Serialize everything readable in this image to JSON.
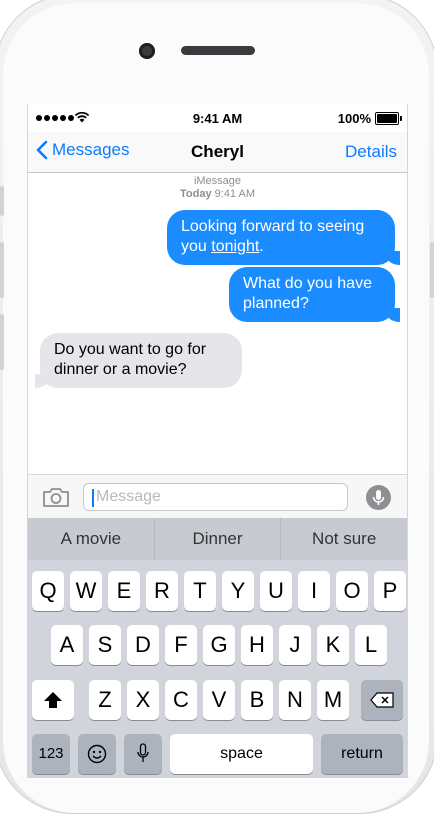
{
  "status_bar": {
    "time": "9:41 AM",
    "battery": "100%"
  },
  "nav": {
    "back_label": "Messages",
    "title": "Cheryl",
    "details_label": "Details"
  },
  "conversation": {
    "service": "iMessage",
    "day": "Today",
    "time": "9:41 AM",
    "messages": [
      {
        "direction": "outgoing",
        "text_before": "Looking forward to seeing you ",
        "link": "tonight",
        "text_after": "."
      },
      {
        "direction": "outgoing",
        "text": "What do you have planned?"
      },
      {
        "direction": "incoming",
        "text": "Do you want to go for dinner or a movie?"
      }
    ]
  },
  "composer": {
    "placeholder": "Message"
  },
  "suggestions": [
    "A movie",
    "Dinner",
    "Not sure"
  ],
  "keyboard": {
    "row1": [
      "Q",
      "W",
      "E",
      "R",
      "T",
      "Y",
      "U",
      "I",
      "O",
      "P"
    ],
    "row2": [
      "A",
      "S",
      "D",
      "F",
      "G",
      "H",
      "J",
      "K",
      "L"
    ],
    "row3": [
      "Z",
      "X",
      "C",
      "V",
      "B",
      "N",
      "M"
    ],
    "numbers_label": "123",
    "space_label": "space",
    "return_label": "return"
  },
  "icons": [
    "back-chevron-icon",
    "camera-icon",
    "microphone-icon",
    "shift-icon",
    "backspace-icon",
    "emoji-icon",
    "dictation-icon",
    "wifi-icon",
    "battery-icon"
  ],
  "colors": {
    "accent": "#0b7bff",
    "outgoing_bubble": "#1a8cff",
    "incoming_bubble": "#e5e5ea",
    "keyboard_bg": "#d1d5db"
  }
}
